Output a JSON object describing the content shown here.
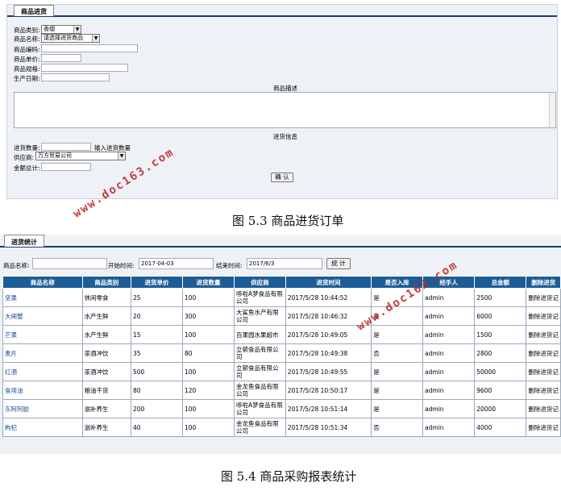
{
  "form": {
    "tab": "商品进货",
    "category_label": "商品类别:",
    "category_value": "香烟",
    "name_label": "商品名称:",
    "name_value": "请选择进货商品",
    "code_label": "商品编码:",
    "price_label": "商品单价:",
    "spec_label": "商品规格:",
    "date_label": "生产日期:",
    "desc_title": "商品描述",
    "stock_title": "进货信息",
    "qty_label": "进货数量:",
    "qty_hint": "输入进货数量",
    "supplier_label": "供应商:",
    "supplier_value": "万方贸易公司",
    "total_label": "金额总计:",
    "confirm_label": "确 认"
  },
  "caption1": "图 5.3 商品进货订单",
  "stats": {
    "tab": "进货统计",
    "name_label": "商品名称:",
    "start_label": "开始时间:",
    "start_value": "2017-04-03",
    "end_label": "结束时间:",
    "end_value": "2017/6/3",
    "btn_label": "统 计"
  },
  "table": {
    "headers": [
      "商品名称",
      "商品类别",
      "进货单价",
      "进货数量",
      "供应商",
      "进货时间",
      "是否入库",
      "经手人",
      "总金额",
      "删除进货"
    ],
    "rows": [
      [
        "坚果",
        "休闲零食",
        "25",
        "100",
        "哆啦A梦食品有限公司",
        "2017/5/28 10:44:52",
        "是",
        "admin",
        "2500",
        "删除进货记"
      ],
      [
        "大闸蟹",
        "水产生鲜",
        "20",
        "300",
        "大鲨鱼水产有限公司",
        "2017/5/28 10:46:32",
        "是",
        "admin",
        "6000",
        "删除进货记"
      ],
      [
        "芒果",
        "水产生鲜",
        "15",
        "100",
        "百果园水果超市",
        "2017/5/28 10:49:05",
        "是",
        "admin",
        "1500",
        "删除进货记"
      ],
      [
        "麦片",
        "茶酒冲饮",
        "35",
        "80",
        "立顿食品有限公司",
        "2017/5/28 10:49:38",
        "否",
        "admin",
        "2800",
        "删除进货记"
      ],
      [
        "红酒",
        "茶酒冲饮",
        "500",
        "100",
        "立顿食品有限公司",
        "2017/5/28 10:49:55",
        "是",
        "admin",
        "50000",
        "删除进货记"
      ],
      [
        "食用油",
        "粮油干货",
        "80",
        "120",
        "金龙鱼食品有限公司",
        "2017/5/28 10:50:17",
        "是",
        "admin",
        "9600",
        "删除进货记"
      ],
      [
        "东阿阿胶",
        "滋补养生",
        "200",
        "100",
        "哆啦A梦食品有限公司",
        "2017/5/28 10:51:14",
        "是",
        "admin",
        "20000",
        "删除进货记"
      ],
      [
        "枸杞",
        "滋补养生",
        "40",
        "100",
        "金龙鱼食品有限公司",
        "2017/5/28 10:51:34",
        "否",
        "admin",
        "4000",
        "删除进货记"
      ]
    ]
  },
  "caption2": "图 5.4 商品采购报表统计",
  "watermark": "www.doc163.com"
}
